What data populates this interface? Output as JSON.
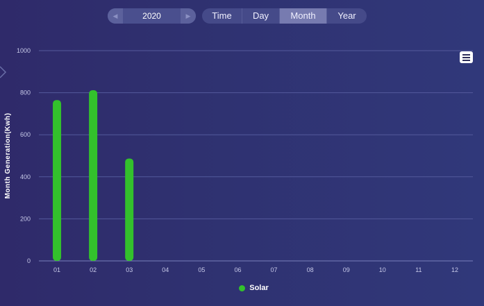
{
  "controls": {
    "year_value": "2020",
    "prev_icon": "step-backward-icon",
    "next_icon": "step-forward-icon",
    "tabs": [
      {
        "label": "Time",
        "active": false
      },
      {
        "label": "Day",
        "active": false
      },
      {
        "label": "Month",
        "active": true
      },
      {
        "label": "Year",
        "active": false
      }
    ],
    "menu_icon": "hamburger-menu-icon"
  },
  "colors": {
    "series": "#33c12c",
    "grid": "#545a9c",
    "axis_text": "#c7c9e8"
  },
  "chart_data": {
    "type": "bar",
    "ylabel": "Month Generation(Kwh)",
    "xlabel": "",
    "title": "",
    "categories": [
      "01",
      "02",
      "03",
      "04",
      "05",
      "06",
      "07",
      "08",
      "09",
      "10",
      "11",
      "12"
    ],
    "series": [
      {
        "name": "Solar",
        "values": [
          765,
          812,
          487,
          null,
          null,
          null,
          null,
          null,
          null,
          null,
          null,
          null
        ]
      }
    ],
    "ylim": [
      0,
      1000
    ],
    "yticks": [
      0,
      200,
      400,
      600,
      800,
      1000
    ],
    "grid": true,
    "legend": "bottom-center"
  }
}
